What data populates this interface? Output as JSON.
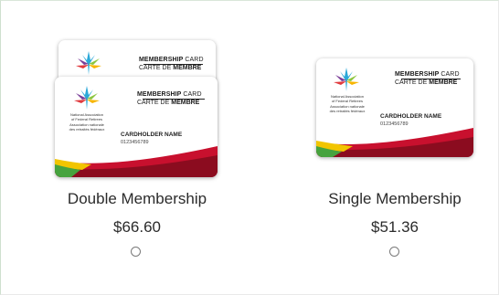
{
  "card": {
    "title_bold": "MEMBERSHIP",
    "title_light": "CARD",
    "subtitle_light": "CARTE DE",
    "subtitle_bold": "MEMBRE",
    "holder_label": "CARDHOLDER NAME",
    "card_number": "0123456789",
    "org_en_1": "National Association",
    "org_en_2": "of Federal Retirees",
    "org_fr_1": "Association nationale",
    "org_fr_2": "des retraités fédéraux"
  },
  "options": [
    {
      "label": "Double Membership",
      "price": "$66.60",
      "selected": false
    },
    {
      "label": "Single Membership",
      "price": "$51.36",
      "selected": false
    }
  ],
  "colors": {
    "swoosh_red": "#c8102e",
    "swoosh_dark_red": "#8b0c1f",
    "swoosh_yellow": "#f2c500",
    "swoosh_green": "#46a33e",
    "leaf_blue": "#2aa8d8",
    "leaf_purple": "#7a3e98",
    "leaf_green": "#8cc63f",
    "leaf_yellow": "#f7b500",
    "leaf_red": "#e03a3e"
  }
}
